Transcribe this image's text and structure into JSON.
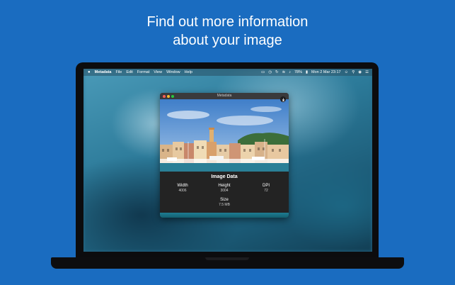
{
  "headline": {
    "line1": "Find out more information",
    "line2": "about your image"
  },
  "menubar": {
    "app_name": "Metadata",
    "items": [
      "File",
      "Edit",
      "Format",
      "View",
      "Window",
      "Help"
    ],
    "battery": "78%",
    "datetime": "Mon 2 Mar 23:17"
  },
  "window": {
    "title": "Metadata",
    "panel_title": "Image Data",
    "fields": {
      "width": {
        "label": "Width",
        "value": "4006"
      },
      "height": {
        "label": "Height",
        "value": "3004"
      },
      "dpi": {
        "label": "DPI",
        "value": "72"
      },
      "size": {
        "label": "Size",
        "value": "7.5 MB"
      }
    }
  },
  "colors": {
    "background": "#1a6cc0",
    "panel": "#232323"
  }
}
